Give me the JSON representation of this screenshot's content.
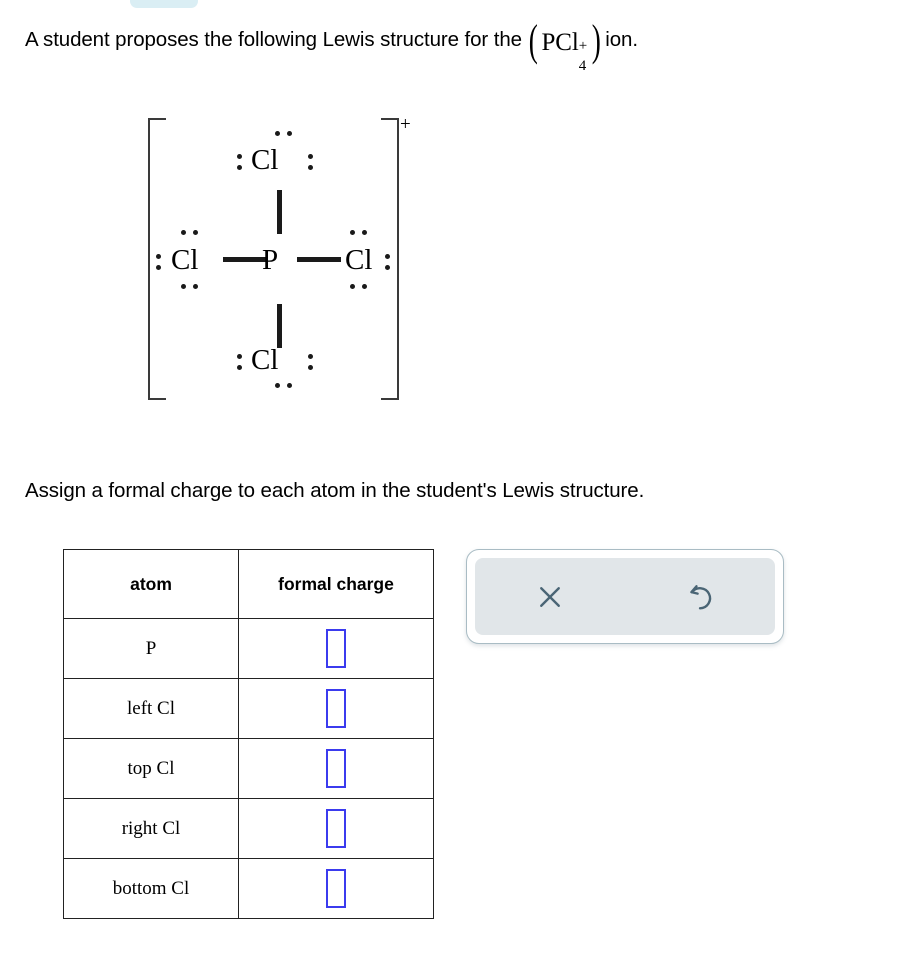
{
  "prompt": {
    "line1_before": "A student proposes the following Lewis structure for the",
    "formula_base": "PCl",
    "formula_superscript": "+",
    "formula_subscript": "4",
    "line1_after": "ion.",
    "line2": "Assign a formal charge to each atom in the student's Lewis structure."
  },
  "lewis_structure": {
    "ion_charge": "+",
    "center_atom": "P",
    "top_atom": "Cl",
    "bottom_atom": "Cl",
    "left_atom": "Cl",
    "right_atom": "Cl",
    "bond_count": 4,
    "bond_type": "single"
  },
  "table": {
    "headers": [
      "atom",
      "formal charge"
    ],
    "rows": [
      {
        "atom": "P",
        "formal_charge": ""
      },
      {
        "atom": "left Cl",
        "formal_charge": ""
      },
      {
        "atom": "top Cl",
        "formal_charge": ""
      },
      {
        "atom": "right Cl",
        "formal_charge": ""
      },
      {
        "atom": "bottom Cl",
        "formal_charge": ""
      }
    ]
  },
  "tool_panel": {
    "clear_icon": "close-x-icon",
    "reset_icon": "reset-undo-icon",
    "icon_color": "#4a6575",
    "panel_bg": "#e1e6e9",
    "panel_border": "#a9bcc4"
  },
  "colors": {
    "answer_box_border": "#3b3bee",
    "table_border": "#222222",
    "top_pill": "#daeef4"
  }
}
